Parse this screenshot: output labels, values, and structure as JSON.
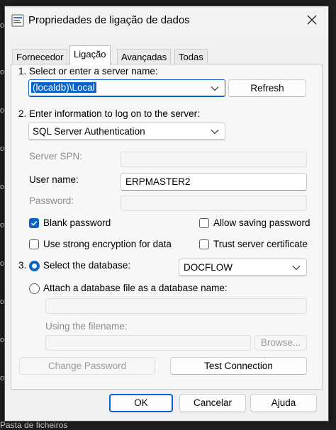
{
  "dialog": {
    "title": "Propriedades de ligação de dados",
    "icon": "data-link-icon",
    "close_icon": "close-icon"
  },
  "tabs": [
    {
      "label": "Fornecedor",
      "active": false
    },
    {
      "label": "Ligação",
      "active": true
    },
    {
      "label": "Avançadas",
      "active": false
    },
    {
      "label": "Todas",
      "active": false
    }
  ],
  "step1": {
    "label": "1. Select or enter a server name:",
    "server_value": "(localdb)\\Local",
    "refresh_label": "Refresh"
  },
  "step2": {
    "label": "2. Enter information to log on to the server:",
    "auth_value": "SQL Server Authentication",
    "spn_label": "Server SPN:",
    "spn_value": "",
    "username_label": "User name:",
    "username_value": "ERPMASTER2",
    "password_label": "Password:",
    "password_value": "",
    "blank_password_label": "Blank password",
    "blank_password_checked": true,
    "allow_saving_label": "Allow saving password",
    "allow_saving_checked": false,
    "strong_encryption_label": "Use strong encryption for data",
    "strong_encryption_checked": false,
    "trust_cert_label": "Trust server certificate",
    "trust_cert_checked": false
  },
  "step3": {
    "number": "3.",
    "select_db_label": "Select the database:",
    "select_db_checked": true,
    "database_value": "DOCFLOW",
    "attach_label": "Attach a database file as a database name:",
    "attach_checked": false,
    "attach_name_value": "",
    "filename_label": "Using the filename:",
    "filename_value": "",
    "browse_label": "Browse..."
  },
  "actions": {
    "change_password_label": "Change Password",
    "test_connection_label": "Test Connection"
  },
  "footer": {
    "ok_label": "OK",
    "cancel_label": "Cancelar",
    "help_label": "Ajuda"
  },
  "background": {
    "text": "Pasta de ficheiros",
    "edge_glyph": "o"
  },
  "colors": {
    "accent": "#0a63c8",
    "dialog_bg": "#f0f0f0",
    "backdrop": "#1f1f1f"
  }
}
